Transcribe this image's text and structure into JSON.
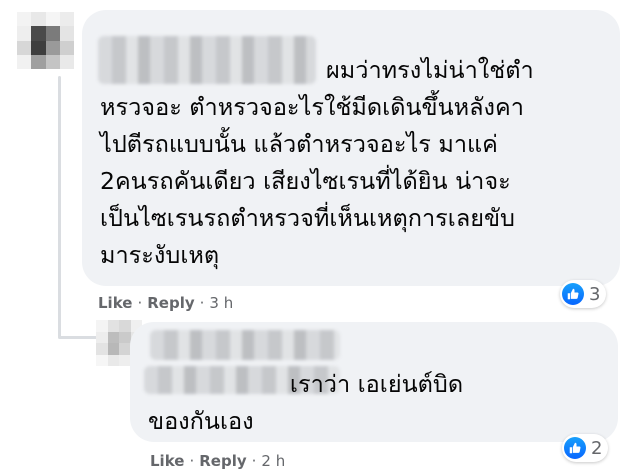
{
  "comments": [
    {
      "text_lines": [
        "ผมว่าทรงไม่น่าใช่ตำ",
        "หรวจอะ ตำหรวจอะไรใช้มีดเดินขึ้นหลังคา",
        "ไปตีรถแบบนั้น แล้วตำหรวจอะไร มาแค่",
        "2คนรถคันเดียว เสียงไซเรนที่ได้ยิน น่าจะ",
        "เป็นไซเรนรถตำหรวจที่เห็นเหตุการเลยขับ",
        "มาระงับเหตุ"
      ],
      "reaction_icon": "like-icon",
      "reaction_count": "3",
      "like_label": "Like",
      "reply_label": "Reply",
      "separator": "·",
      "timestamp": "3 h"
    },
    {
      "text_lines": [
        "                   เราว่า เอเย่นต์บิด",
        "ของกันเอง"
      ],
      "reaction_icon": "like-icon",
      "reaction_count": "2",
      "like_label": "Like",
      "reply_label": "Reply",
      "separator": "·",
      "timestamp": "2 h"
    }
  ],
  "colors": {
    "bubble": "#f0f2f5",
    "text": "#050505",
    "meta": "#65676b",
    "like_blue": "#0866ff"
  }
}
